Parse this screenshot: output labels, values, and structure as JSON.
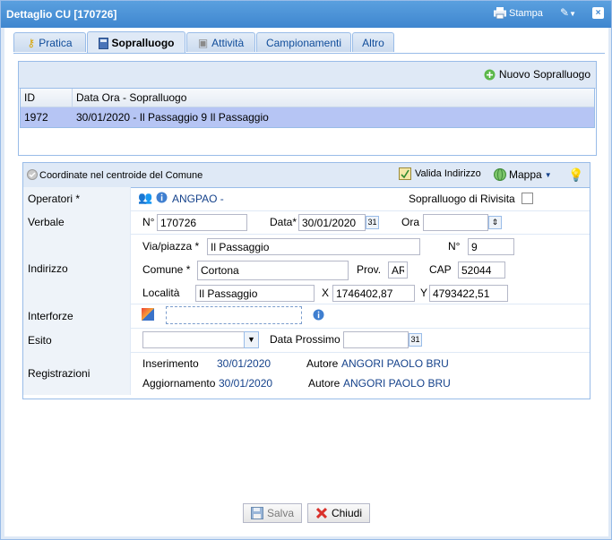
{
  "window": {
    "title": "Dettaglio CU [170726]",
    "print_label": "Stampa"
  },
  "tabs": [
    {
      "label": "Pratica"
    },
    {
      "label": "Sopralluogo"
    },
    {
      "label": "Attività"
    },
    {
      "label": "Campionamenti"
    },
    {
      "label": "Altro"
    }
  ],
  "list_panel": {
    "new_button": "Nuovo Sopralluogo",
    "columns": [
      "ID",
      "Data Ora - Sopralluogo"
    ],
    "rows": [
      {
        "id": "1972",
        "desc": "30/01/2020 - Il Passaggio  9 Il Passaggio"
      }
    ]
  },
  "form": {
    "header": "Coordinate nel centroide del Comune",
    "valida_label": "Valida Indirizzo",
    "mappa_label": "Mappa",
    "operatori": {
      "label": "Operatori *",
      "value": "ANGPAO -",
      "rivisita_label": "Sopralluogo di Rivisita"
    },
    "verbale": {
      "label": "Verbale",
      "num_label": "N°",
      "num_value": "170726",
      "data_label": "Data*",
      "data_value": "30/01/2020",
      "ora_label": "Ora",
      "ora_value": ""
    },
    "indirizzo": {
      "label": "Indirizzo",
      "via_label": "Via/piazza *",
      "via_value": "Il Passaggio",
      "n_label": "N°",
      "n_value": "9",
      "comune_label": "Comune *",
      "comune_value": "Cortona",
      "prov_label": "Prov.",
      "prov_value": "AR",
      "cap_label": "CAP",
      "cap_value": "52044",
      "localita_label": "Località",
      "localita_value": "Il Passaggio",
      "x_label": "X",
      "x_value": "1746402,87",
      "y_label": "Y",
      "y_value": "4793422,51"
    },
    "interforze": {
      "label": "Interforze",
      "value": ""
    },
    "esito": {
      "label": "Esito",
      "value": "",
      "prossimo_label": "Data Prossimo",
      "prossimo_value": ""
    },
    "registrazioni": {
      "label": "Registrazioni",
      "inserimento_label": "Inserimento",
      "inserimento_date": "30/01/2020",
      "autore_label": "Autore",
      "inserimento_autore": "ANGORI PAOLO BRU",
      "aggiornamento_label": "Aggiornamento",
      "aggiornamento_date": "30/01/2020",
      "aggiornamento_autore": "ANGORI PAOLO BRU"
    }
  },
  "footer": {
    "save_label": "Salva",
    "close_label": "Chiudi"
  },
  "colors": {
    "title_bar": "#3f86cf",
    "panel_border": "#99bce8",
    "selected_row": "#b6c5f4",
    "link_blue": "#15428b"
  }
}
